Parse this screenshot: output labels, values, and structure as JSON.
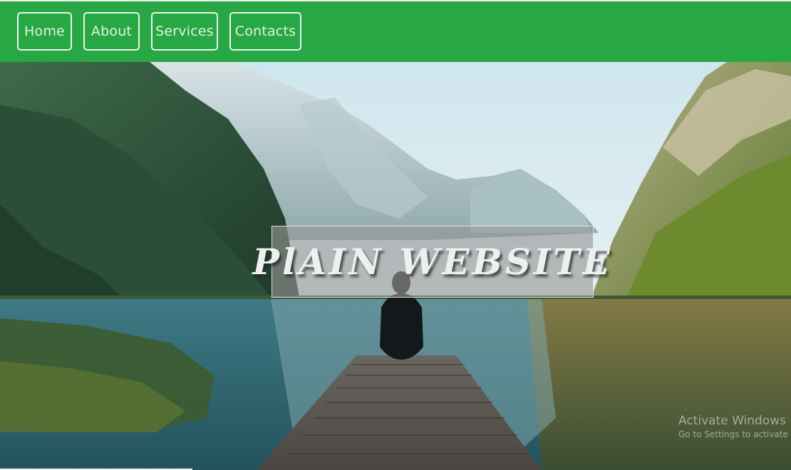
{
  "nav": {
    "items": [
      {
        "label": "Home"
      },
      {
        "label": "About"
      },
      {
        "label": "Services"
      },
      {
        "label": "Contacts"
      }
    ],
    "background_color": "#28a745"
  },
  "hero": {
    "title": "PlAIN WEBSITE",
    "image_description_icon": "landscape-image"
  },
  "watermark": {
    "line1": "Activate Windows",
    "line2": "Go to Settings to activate"
  }
}
